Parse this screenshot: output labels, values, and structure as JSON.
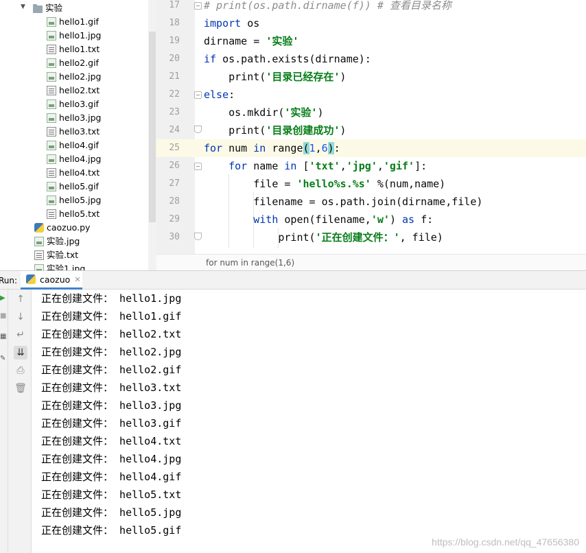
{
  "project_tree": {
    "folder": "实验",
    "files": [
      "hello1.gif",
      "hello1.jpg",
      "hello1.txt",
      "hello2.gif",
      "hello2.jpg",
      "hello2.txt",
      "hello3.gif",
      "hello3.jpg",
      "hello3.txt",
      "hello4.gif",
      "hello4.jpg",
      "hello4.txt",
      "hello5.gif",
      "hello5.jpg",
      "hello5.txt"
    ],
    "root_files": [
      "caozuo.py",
      "实验.jpg",
      "实验.txt",
      "实验1.jpg"
    ]
  },
  "editor": {
    "line_numbers": [
      "17",
      "18",
      "19",
      "20",
      "21",
      "22",
      "23",
      "24",
      "25",
      "26",
      "27",
      "28",
      "29",
      "30"
    ],
    "breadcrumb": "for num in range(1,6)",
    "code": {
      "l17": "# print(os.path.dirname(f)) # 查看目录名称",
      "l18_kw": "import",
      "l18_rest": " os",
      "l19_a": "dirname = ",
      "l19_str": "'实验'",
      "l20_kw": "if",
      "l20_rest": " os.path.exists(dirname):",
      "l21_a": "    print(",
      "l21_str": "'目录已经存在'",
      "l21_b": ")",
      "l22_kw": "else",
      "l22_rest": ":",
      "l23_a": "    os.mkdir(",
      "l23_str": "'实验'",
      "l23_b": ")",
      "l24_a": "    print(",
      "l24_str": "'目录创建成功'",
      "l24_b": ")",
      "l25_kw1": "for",
      "l25_a": " num ",
      "l25_kw2": "in",
      "l25_b": " range",
      "l25_p1": "(",
      "l25_n1": "1",
      "l25_c": ",",
      "l25_n2": "6",
      "l25_p2": ")",
      "l25_d": ":",
      "l26_ind": "    ",
      "l26_kw1": "for",
      "l26_a": " name ",
      "l26_kw2": "in",
      "l26_b": " [",
      "l26_s1": "'txt'",
      "l26_c1": ",",
      "l26_s2": "'jpg'",
      "l26_c2": ",",
      "l26_s3": "'gif'",
      "l26_d": "]:",
      "l27_a": "        file = ",
      "l27_str": "'hello%s.%s'",
      "l27_b": " %(num,name)",
      "l28": "        filename = os.path.join(dirname,file)",
      "l29_ind": "        ",
      "l29_kw1": "with",
      "l29_a": " open(filename,",
      "l29_str": "'w'",
      "l29_b": ") ",
      "l29_kw2": "as",
      "l29_c": " f:",
      "l30_a": "            print(",
      "l30_str": "'正在创建文件：'",
      "l30_b": ", file)"
    }
  },
  "run": {
    "label": "Run:",
    "tab": "caozuo",
    "output_prefix": "正在创建文件：",
    "output": [
      "hello1.jpg",
      "hello1.gif",
      "hello2.txt",
      "hello2.jpg",
      "hello2.gif",
      "hello3.txt",
      "hello3.jpg",
      "hello3.gif",
      "hello4.txt",
      "hello4.jpg",
      "hello4.gif",
      "hello5.txt",
      "hello5.jpg",
      "hello5.gif"
    ]
  },
  "watermark": "https://blog.csdn.net/qq_47656380"
}
